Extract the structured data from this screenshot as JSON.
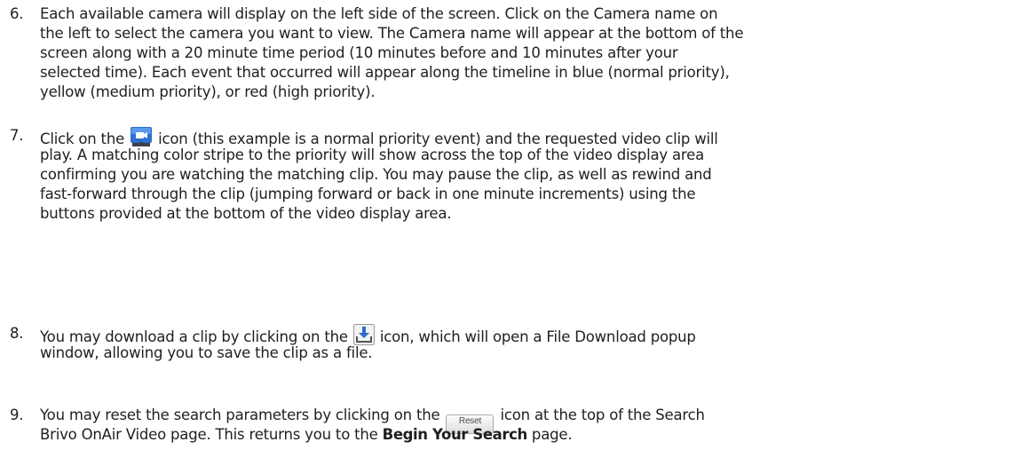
{
  "steps": [
    {
      "number": "6.",
      "lines": [
        "Each available camera will display on the left side of the screen. Click on the Camera name on",
        "the left to select the camera you want to view. The Camera name will appear at the bottom of the",
        "screen along with a 20 minute time period (10 minutes before and 10 minutes after your",
        "selected time). Each event that occurred will appear along the timeline in blue (normal priority),",
        "yellow (medium priority), or red (high priority)."
      ]
    },
    {
      "number": "7.",
      "line1_before_icon": "Click on the",
      "line1_after_icon": "icon (this example is a normal priority event) and the requested video clip will",
      "icon": "video-camera-icon",
      "lines": [
        "play. A matching color stripe to the priority will show across the top of the video display area",
        "confirming you are watching the matching clip. You may pause the clip, as well as rewind and",
        "fast-forward through the clip (jumping forward or back in one minute increments) using the",
        "buttons provided at the bottom of the video display area."
      ]
    },
    {
      "number": "8.",
      "line1_before_icon": "You may download a clip by clicking on the",
      "line1_after_icon": "icon, which will open a File Download popup",
      "icon": "download-icon",
      "lines": [
        "window, allowing you to save the clip as a file."
      ]
    },
    {
      "number": "9.",
      "line1_before_icon": "You may reset the search parameters by clicking on the",
      "button_label": "Reset",
      "line1_after_icon": "icon at the top of the Search",
      "line2_before_bold": "Brivo OnAir Video page.  This returns you to the",
      "line2_bold": "Begin Your Search",
      "line2_after_bold": "page."
    }
  ],
  "colors": {
    "text": "#1f1f1f",
    "camera_icon_blue": "#2b6fd1",
    "camera_icon_dark": "#3a3f4a",
    "download_arrow": "#2f6cc4"
  }
}
